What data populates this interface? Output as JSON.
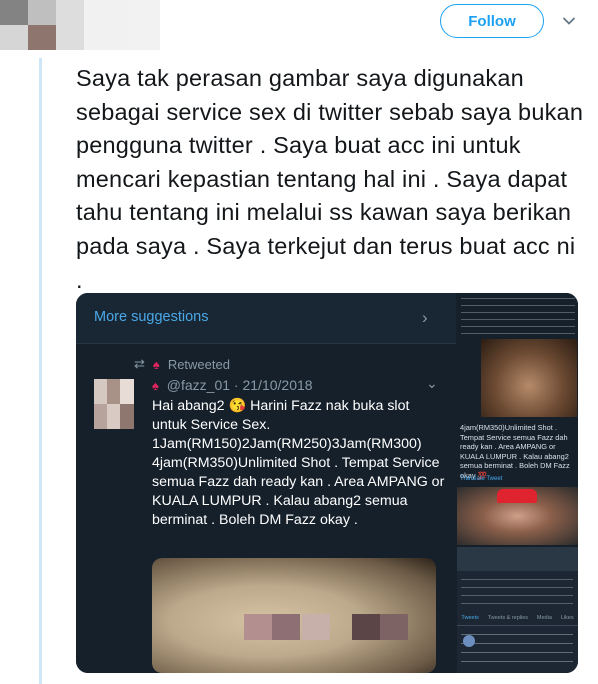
{
  "header": {
    "follow_label": "Follow",
    "chevron_icon": "chevron-down-icon",
    "accent_color": "#1da1f2"
  },
  "tweet": {
    "text": "Saya tak perasan gambar saya digunakan sebagai service sex di twitter sebab saya bukan pengguna twitter . Saya buat acc ini untuk mencari kepastian tentang hal ini . Saya dapat tahu tentang ini melalui ss kawan saya berikan pada saya . Saya terkejut dan terus buat acc ni ."
  },
  "screenshot": {
    "suggestions_label": "More suggestions",
    "retweeted_label": "Retweeted",
    "handle_date": "@fazz_01 · 21/10/2018",
    "body": "Hai abang2 😘 Harini Fazz nak buka slot untuk Service Sex. 1Jam(RM150)2Jam(RM250)3Jam(RM300) 4jam(RM350)Unlimited Shot . Tempat Service semua Fazz dah ready kan . Area AMPANG or KUALA LUMPUR . Kalau abang2 semua berminat . Boleh DM Fazz okay ."
  },
  "thumb2": {
    "text": "4jam(RM350)Unlimited Shot . Tempat Service semua Fazz dah ready kan . Area AMPANG or KUALA LUMPUR . Kalau abang2 semua berminat . Boleh DM Fazz okay 💯",
    "translate": "Translate Tweet"
  },
  "thumb3": {
    "tabs": [
      "Tweets",
      "Tweets & replies",
      "Media",
      "Likes"
    ]
  }
}
